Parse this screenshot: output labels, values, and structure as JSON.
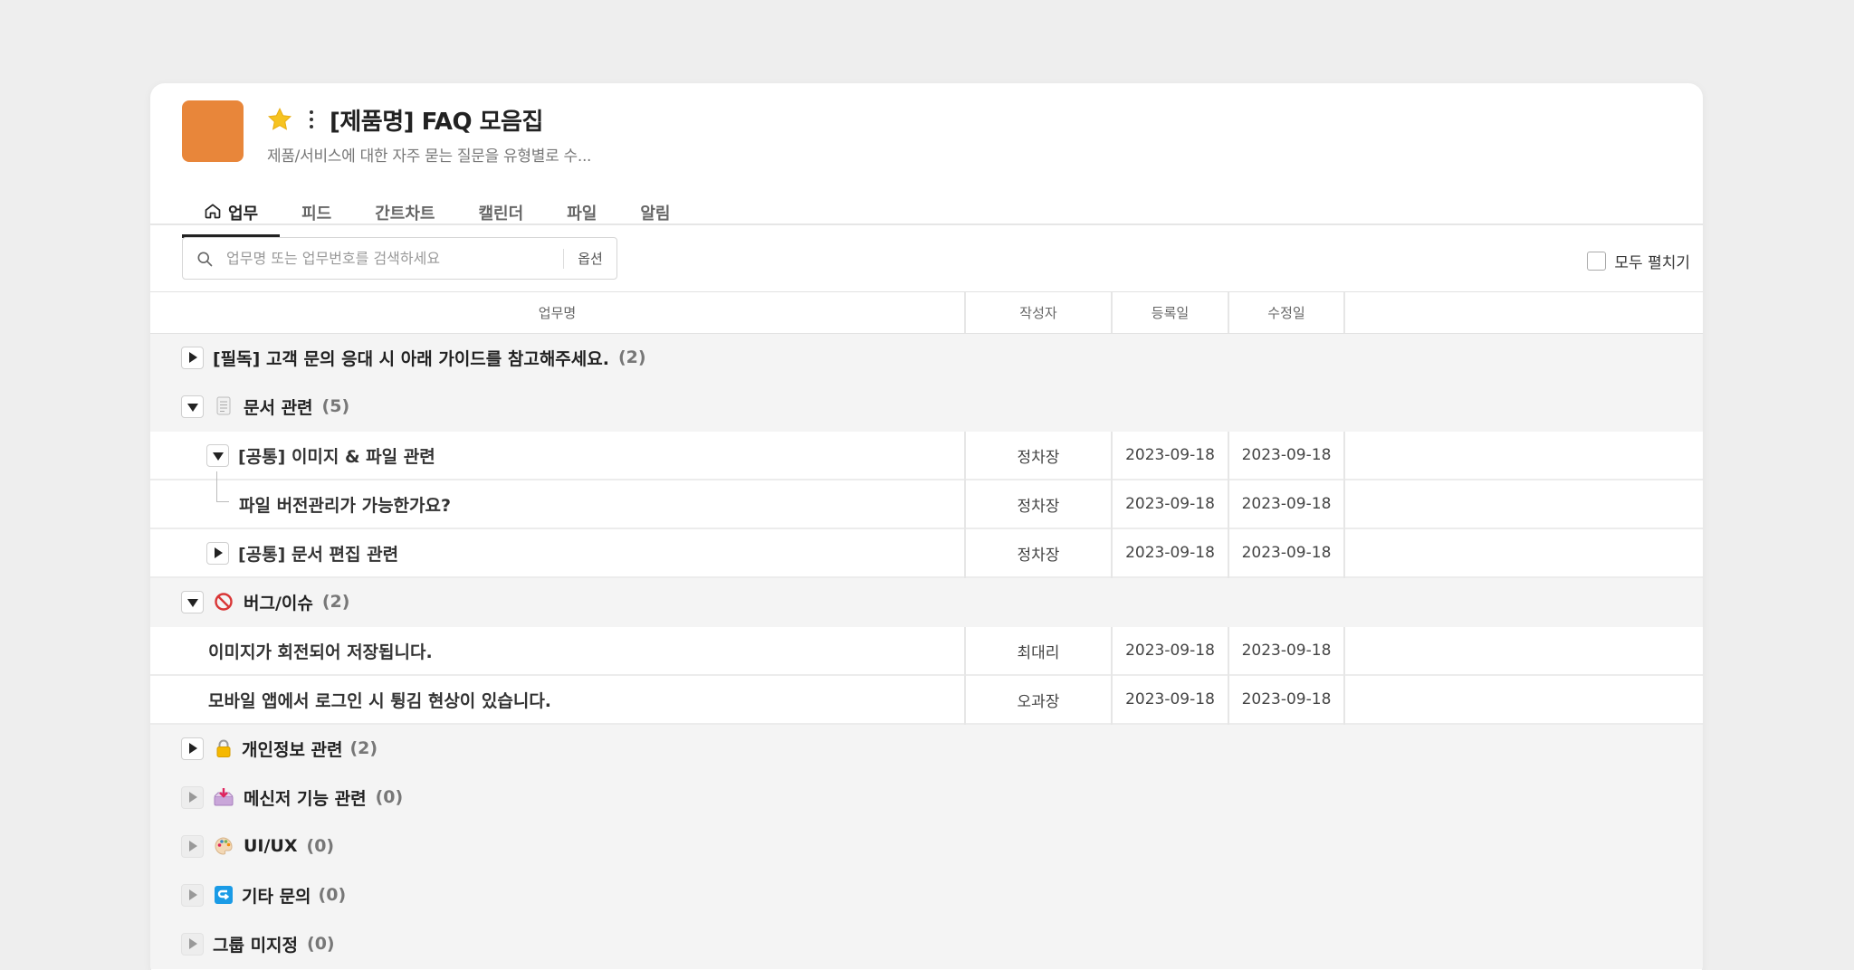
{
  "project": {
    "title": "[제품명] FAQ 모음집",
    "description": "제품/서비스에 대한 자주 묻는 질문을 유형별로 수...",
    "icon_color": "#e8863a",
    "favorite": true
  },
  "tabs": [
    {
      "label": "업무",
      "active": true,
      "icon": "home-icon"
    },
    {
      "label": "피드"
    },
    {
      "label": "간트차트"
    },
    {
      "label": "캘린더"
    },
    {
      "label": "파일"
    },
    {
      "label": "알림"
    }
  ],
  "search": {
    "placeholder": "업무명 또는 업무번호를 검색하세요",
    "option_label": "옵션"
  },
  "expand_all_label": "모두 펼치기",
  "table": {
    "columns": [
      "업무명",
      "작성자",
      "등록일",
      "수정일"
    ],
    "rows": [
      {
        "type": "group",
        "name": "[필독] 고객 문의 응대 시 아래 가이드를 참고해주세요.",
        "count": "(2)",
        "toggle": "collapsed"
      },
      {
        "type": "group",
        "name": "문서 관련",
        "count": "(5)",
        "toggle": "expanded",
        "icon": "document-icon"
      },
      {
        "type": "item",
        "name": "[공통] 이미지 & 파일 관련",
        "author": "정차장",
        "created": "2023-09-18",
        "modified": "2023-09-18",
        "toggle": "expanded"
      },
      {
        "type": "item",
        "name": "파일 버전관리가 가능한가요?",
        "author": "정차장",
        "created": "2023-09-18",
        "modified": "2023-09-18"
      },
      {
        "type": "item",
        "name": "[공통] 문서 편집 관련",
        "author": "정차장",
        "created": "2023-09-18",
        "modified": "2023-09-18",
        "toggle": "collapsed"
      },
      {
        "type": "group",
        "name": "버그/이슈",
        "count": "(2)",
        "toggle": "expanded",
        "icon": "prohibited-icon"
      },
      {
        "type": "item",
        "name": "이미지가 회전되어 저장됩니다.",
        "author": "최대리",
        "created": "2023-09-18",
        "modified": "2023-09-18"
      },
      {
        "type": "item",
        "name": "모바일 앱에서 로그인 시 튕김 현상이 있습니다.",
        "author": "오과장",
        "created": "2023-09-18",
        "modified": "2023-09-18"
      },
      {
        "type": "group",
        "name": "개인정보 관련",
        "count": "(2)",
        "toggle": "collapsed",
        "icon": "lock-icon"
      },
      {
        "type": "group",
        "name": "메신저 기능 관련",
        "count": "(0)",
        "toggle": "disabled",
        "icon": "inbox-tray-icon"
      },
      {
        "type": "group",
        "name": "UI/UX",
        "count": "(0)",
        "toggle": "disabled",
        "icon": "palette-icon"
      },
      {
        "type": "group",
        "name": "기타 문의",
        "count": "(0)",
        "toggle": "disabled",
        "icon": "return-arrow-icon"
      },
      {
        "type": "group",
        "name": "그룹 미지정",
        "count": "(0)",
        "toggle": "disabled"
      }
    ]
  }
}
